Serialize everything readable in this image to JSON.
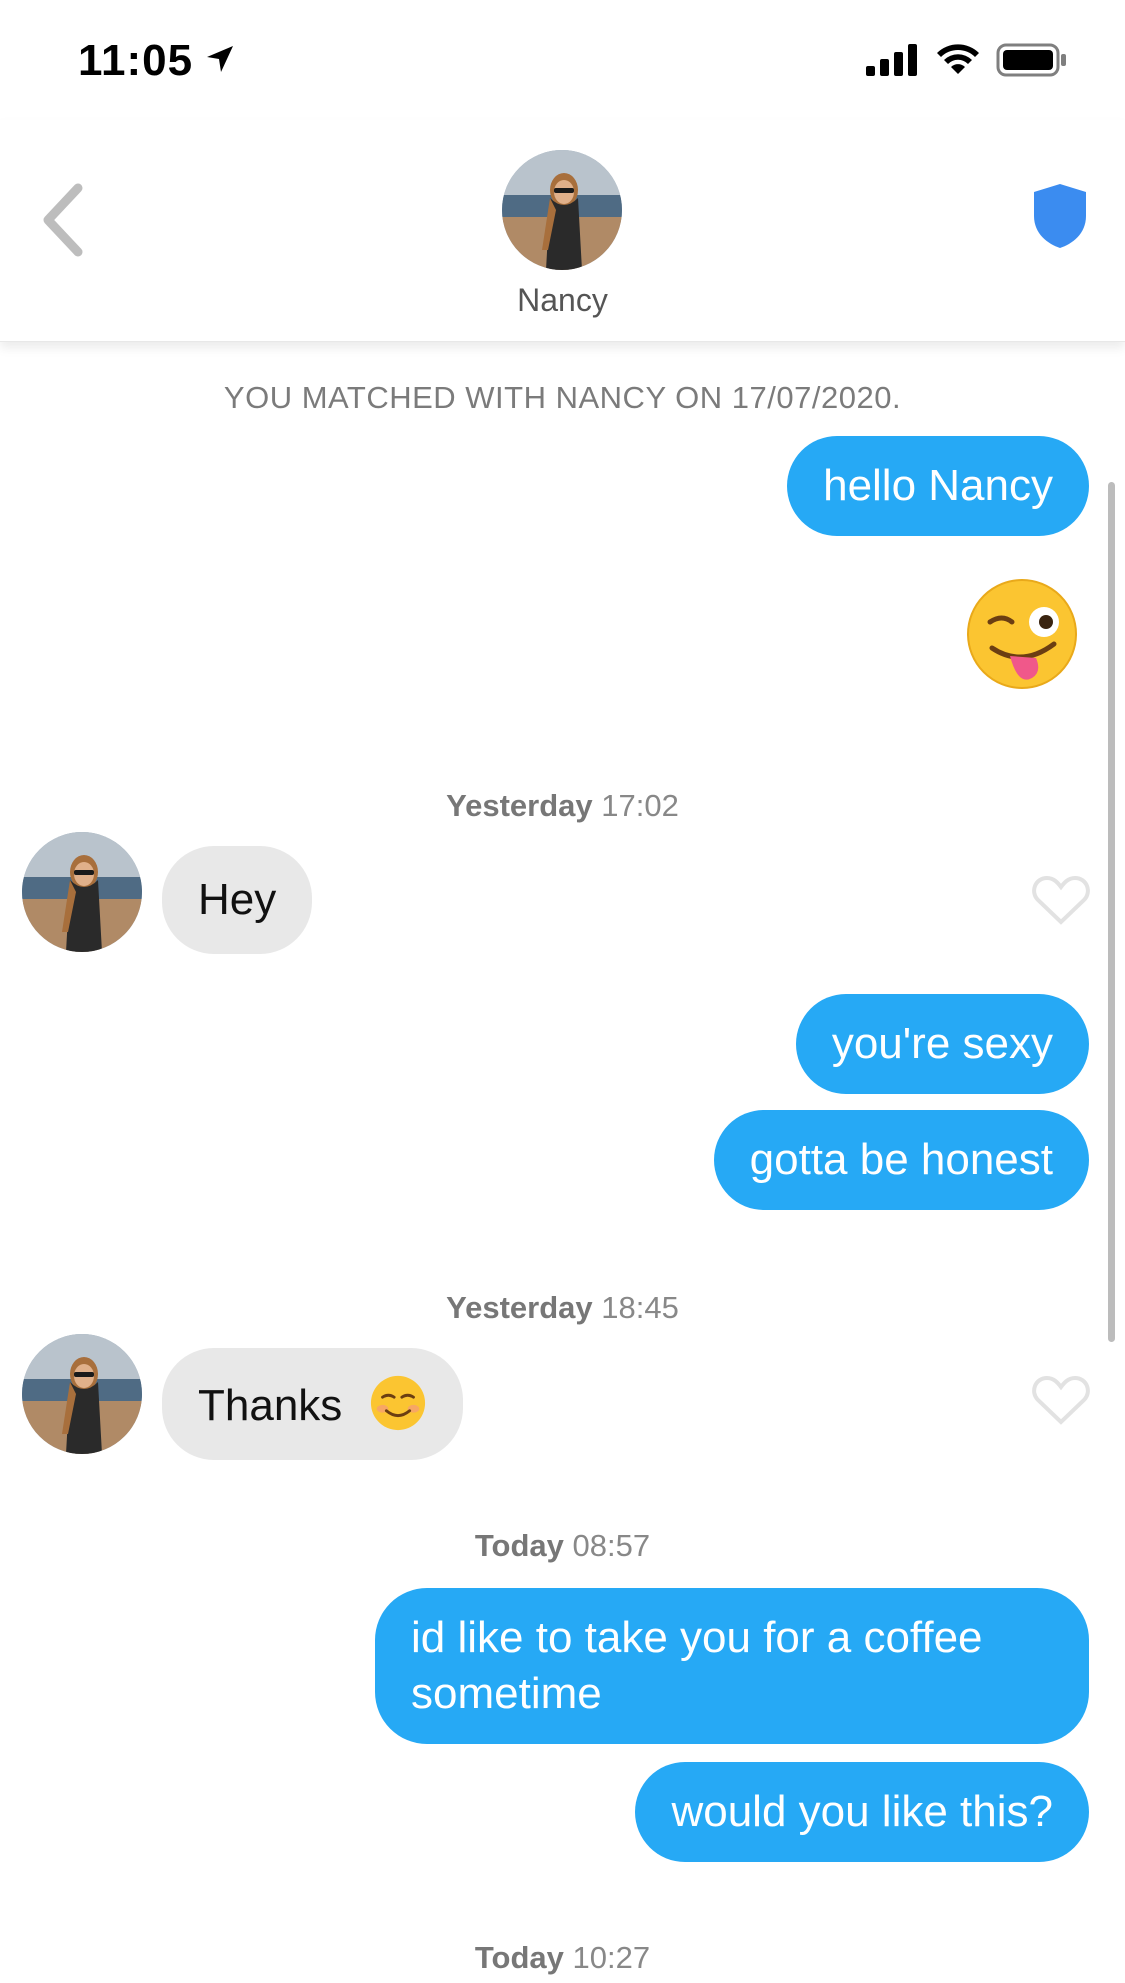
{
  "status_bar": {
    "time": "11:05",
    "icons": [
      "location-arrow-icon",
      "signal-bars-icon",
      "wifi-icon",
      "battery-icon"
    ]
  },
  "header": {
    "name": "Nancy",
    "icons": [
      "chevron-left-icon",
      "shield-icon"
    ],
    "accent_color": "#3b8cf0"
  },
  "chat": {
    "matched_notice": "YOU MATCHED WITH NANCY ON 17/07/2020.",
    "timestamps": [
      {
        "day": "Yesterday",
        "time": "17:02"
      },
      {
        "day": "Yesterday",
        "time": "18:45"
      },
      {
        "day": "Today",
        "time": "08:57"
      },
      {
        "day": "Today",
        "time": "10:27"
      }
    ],
    "messages": {
      "m1": "hello Nancy",
      "m2_emoji": "winking-face-with-tongue",
      "m3": "Hey",
      "m4": "you're sexy",
      "m5": "gotta be honest",
      "m6": "Thanks",
      "m6_emoji": "smiling-face",
      "m7": "id like to take you for a coffee sometime",
      "m8": "would you like this?"
    },
    "colors": {
      "outgoing_bubble": "#26a9f5",
      "incoming_bubble": "#e8e8e8"
    }
  }
}
